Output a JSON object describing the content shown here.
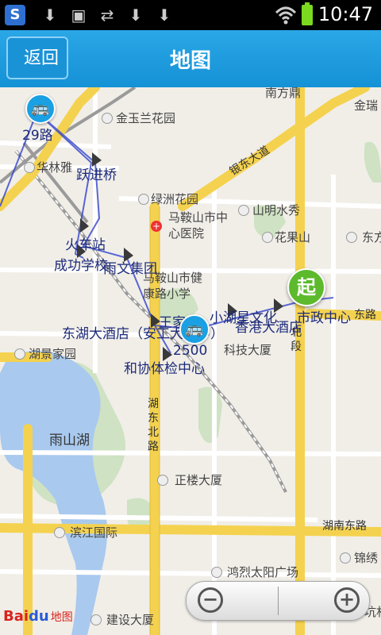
{
  "status_bar": {
    "time": "10:47",
    "app_icon": "S",
    "icons": [
      "download-icon",
      "image-icon",
      "sync-icon",
      "download-icon",
      "download-icon",
      "wifi-icon",
      "battery-icon"
    ]
  },
  "header": {
    "back_label": "返回",
    "title": "地图"
  },
  "map": {
    "place_labels": [
      "南方鼎",
      "金瑞",
      "金玉兰花园",
      "华林雅",
      "绿洲花园",
      "马鞍山市中心医院",
      "山明水秀",
      "花果山",
      "东方",
      "马鞍山市健康路小学",
      "湖景家园",
      "科技大厦",
      "雨山湖",
      "正楼大厦",
      "滨江国际",
      "锦绣",
      "鸿烈太阳广场",
      "建设大厦",
      "一坑村"
    ],
    "road_labels": [
      "银东大道",
      "湖东北路",
      "湖南东路",
      "北段",
      "东路"
    ],
    "bus_stop_labels": [
      "29路",
      "跃进桥",
      "火车站",
      "成功学校",
      "雨文集团",
      "东湖大酒店（安工大附中）",
      "王家",
      "2500",
      "和协体检中心",
      "小湖星文化",
      "香港大酒店",
      "市政中心"
    ],
    "start_marker": "起"
  },
  "zoom": {
    "zoom_out": "−",
    "zoom_in": "+"
  },
  "logo": {
    "text_bai": "Bai",
    "text_du": "du",
    "text_map": "地图"
  }
}
